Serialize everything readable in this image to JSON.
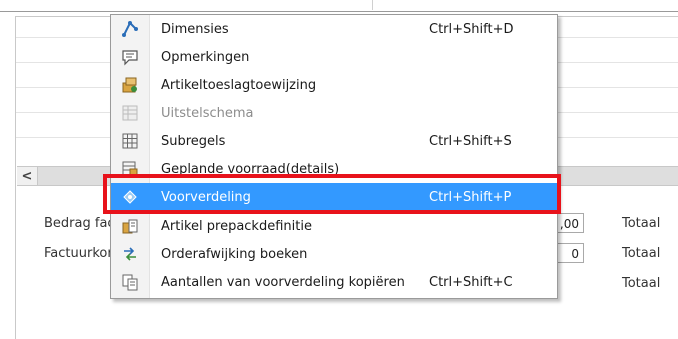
{
  "form": {
    "label_bedrag": "Bedrag fac",
    "label_factuurkor": "Factuurkor",
    "input_bedrag_value": ",00",
    "input_factuur_value": "0",
    "totaal_1": "Totaal",
    "totaal_2": "Totaal",
    "totaal_3": "Totaal",
    "scroll_left_glyph": "<"
  },
  "menu": {
    "items": [
      {
        "label": "Dimensies",
        "shortcut": "Ctrl+Shift+D",
        "icon": "dimensions-icon"
      },
      {
        "label": "Opmerkingen",
        "shortcut": "",
        "icon": "comment-icon"
      },
      {
        "label": "Artikeltoeslagtoewijzing",
        "shortcut": "",
        "icon": "item-charge-icon"
      },
      {
        "label": "Uitstelschema",
        "shortcut": "",
        "icon": "deferral-schedule-icon",
        "disabled": true
      },
      {
        "label": "Subregels",
        "shortcut": "Ctrl+Shift+S",
        "icon": "grid-icon"
      },
      {
        "label": "Geplande voorraad(details)",
        "shortcut": "",
        "icon": "planned-inventory-icon"
      },
      {
        "label": "Voorverdeling",
        "shortcut": "Ctrl+Shift+P",
        "icon": "predistribution-icon",
        "highlighted": true
      },
      {
        "label": "Artikel prepackdefinitie",
        "shortcut": "",
        "icon": "prepack-icon"
      },
      {
        "label": "Orderafwijking boeken",
        "shortcut": "",
        "icon": "order-deviation-icon"
      },
      {
        "label": "Aantallen van voorverdeling kopiëren",
        "shortcut": "Ctrl+Shift+C",
        "icon": "copy-icon"
      }
    ]
  },
  "colors": {
    "highlight": "#3399ff",
    "annotation_box": "#e8121b"
  }
}
